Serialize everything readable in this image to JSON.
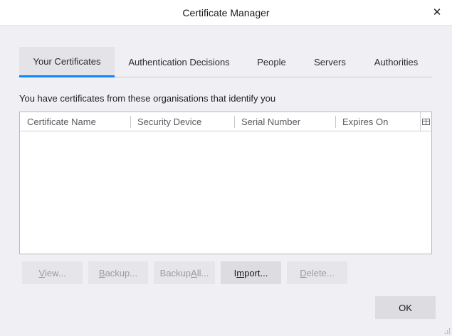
{
  "window": {
    "title": "Certificate Manager",
    "close_glyph": "✕"
  },
  "tabs": [
    {
      "label": "Your Certificates",
      "selected": true
    },
    {
      "label": "Authentication Decisions",
      "selected": false
    },
    {
      "label": "People",
      "selected": false
    },
    {
      "label": "Servers",
      "selected": false
    },
    {
      "label": "Authorities",
      "selected": false
    }
  ],
  "description": "You have certificates from these organisations that identify you",
  "table": {
    "columns": [
      "Certificate Name",
      "Security Device",
      "Serial Number",
      "Expires On"
    ],
    "rows": [],
    "column_picker_icon": "column-picker-icon"
  },
  "buttons": {
    "view": {
      "label_u": "V",
      "label_rest": "iew...",
      "enabled": false
    },
    "backup": {
      "label_u": "B",
      "label_rest": "ackup...",
      "enabled": false
    },
    "backup_all": {
      "label_pre": "Backup ",
      "label_u": "A",
      "label_rest": "ll...",
      "enabled": false
    },
    "import": {
      "label_pre": "I",
      "label_u": "m",
      "label_rest": "port...",
      "enabled": true
    },
    "delete": {
      "label_u": "D",
      "label_rest": "elete...",
      "enabled": false
    },
    "ok": "OK"
  },
  "colors": {
    "accent": "#0a84ff",
    "dialog_bg": "#f0f0f4",
    "disabled_text": "#9a9aa0"
  }
}
